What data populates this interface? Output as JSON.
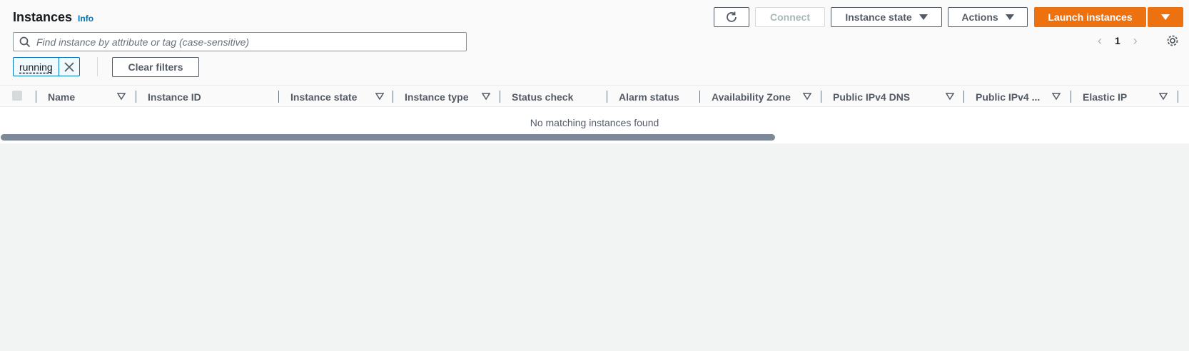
{
  "header": {
    "title": "Instances",
    "info_label": "Info"
  },
  "toolbar": {
    "refresh_icon": "refresh-icon",
    "connect_label": "Connect",
    "instance_state_label": "Instance state",
    "actions_label": "Actions",
    "launch_label": "Launch instances"
  },
  "search": {
    "placeholder": "Find instance by attribute or tag (case-sensitive)"
  },
  "pagination": {
    "current_page": "1"
  },
  "filters": {
    "token_label": "running",
    "clear_label": "Clear filters"
  },
  "table": {
    "columns": [
      "Name",
      "Instance ID",
      "Instance state",
      "Instance type",
      "Status check",
      "Alarm status",
      "Availability Zone",
      "Public IPv4 DNS",
      "Public IPv4 ...",
      "Elastic IP"
    ],
    "empty_message": "No matching instances found"
  },
  "colors": {
    "primary": "#ec7211",
    "link": "#0073bb",
    "background": "#f2f3f3"
  }
}
